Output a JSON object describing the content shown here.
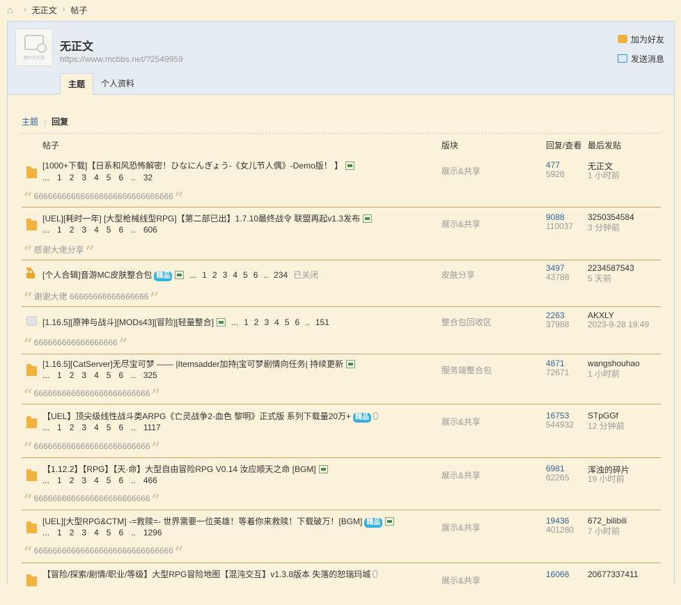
{
  "breadcrumb": {
    "items": [
      "无正文",
      "帖子"
    ]
  },
  "profile": {
    "avatar_caption": "图片已失效",
    "name": "无正文",
    "url": "https://www.mcbbs.net/?2549959",
    "add_friend": "加为好友",
    "send_message": "发送消息",
    "tabs": [
      "主题",
      "个人资料"
    ]
  },
  "subnav": {
    "threads": "主题",
    "replies": "回复"
  },
  "table": {
    "headers": {
      "post": "帖子",
      "forum": "版块",
      "counts": "回复/查看",
      "lastpost": "最后发贴"
    },
    "rows": [
      {
        "title": "[1000+下载]【日系和风恐怖解密！ひなにんぎょう-《女儿节人偶》-Demo版！ 】",
        "pages": [
          "...",
          "1",
          "2",
          "3",
          "4",
          "5",
          "6",
          "..",
          "32"
        ],
        "forum": "展示&共享",
        "replies": "477",
        "views": "5928",
        "last_user": "无正文",
        "last_time": "1 小时前",
        "reply_text": "666666666666666666666666666666"
      },
      {
        "title": "[UEL][耗时一年] [大型枪械线型RPG]【第二部已出】1.7.10最终战令 联盟再起v1.3发布",
        "pages": [
          "...",
          "1",
          "2",
          "3",
          "4",
          "5",
          "6",
          "..",
          "606"
        ],
        "forum": "展示&共享",
        "replies": "9088",
        "views": "110037",
        "last_user": "3250354584",
        "last_time": "3 分钟前",
        "reply_text": "感谢大佬分享"
      },
      {
        "title": "[个人合辑]音游MC皮肤整合包",
        "badge": "精品",
        "pages": [
          "...",
          "1",
          "2",
          "3",
          "4",
          "5",
          "6",
          "..",
          "234"
        ],
        "closed": "已关闭",
        "forum": "皮肤分享",
        "replies": "3497",
        "views": "43788",
        "last_user": "2234587543",
        "last_time": "5 天前",
        "reply_text": "谢谢大佬 66666666666666666"
      },
      {
        "title": "[1.16.5][原神与战斗][MODs43][冒险][轻量整合]",
        "pages": [
          "...",
          "1",
          "2",
          "3",
          "4",
          "5",
          "6",
          "..",
          "151"
        ],
        "forum": "整合包回收区",
        "replies": "2263",
        "views": "37988",
        "last_user": "AKXLY",
        "last_time": "2023-9-28 19:49",
        "reply_text": "666666666666666666"
      },
      {
        "title": "[1.16.5][CatServer]无尽宝可梦 —— |Itemsadder加持|宝可梦剧情向任务| 持续更新",
        "pages": [
          "...",
          "1",
          "2",
          "3",
          "4",
          "5",
          "6",
          "..",
          "325"
        ],
        "forum": "服务端整合包",
        "replies": "4871",
        "views": "72671",
        "last_user": "wangshouhao",
        "last_time": "1 小时前",
        "reply_text": "6666666666666666666666666"
      },
      {
        "title": "【UEL】顶尖级线性战斗类ARPG《亡灵战争2-血色 黎明》正式版 系列下载量20万+",
        "badge": "精品",
        "pages": [
          "...",
          "1",
          "2",
          "3",
          "4",
          "5",
          "6",
          "..",
          "1117"
        ],
        "forum": "展示&共享",
        "replies": "16753",
        "views": "544932",
        "last_user": "STpGGf",
        "last_time": "12 分钟前",
        "reply_text": "6666666666666666666666666"
      },
      {
        "title": "【1.12.2】【RPG】【天·命】大型自由冒险RPG V0.14 汝应顺天之命 [BGM]",
        "pages": [
          "...",
          "1",
          "2",
          "3",
          "4",
          "5",
          "6",
          "..",
          "466"
        ],
        "forum": "展示&共享",
        "replies": "6981",
        "views": "62265",
        "last_user": "浑浊的碎片",
        "last_time": "19 小时前",
        "reply_text": "6666666666666666666666666"
      },
      {
        "title": "[UEL][大型RPG&CTM] -=救赎=- 世界需要一位英雄！等着你来救赎！下载破万！[BGM]",
        "badge": "精品",
        "pages": [
          "...",
          "1",
          "2",
          "3",
          "4",
          "5",
          "6",
          "..",
          "1296"
        ],
        "forum": "展示&共享",
        "replies": "19436",
        "views": "401280",
        "last_user": "672_bilibili",
        "last_time": "7 小时前",
        "reply_text": "666666666666666666666666666666"
      },
      {
        "title": "【冒险/探索/剧情/职业/等级】大型RPG冒险地图【混沌交互】v1.3.8版本 失落的恕瑞玛城",
        "forum": "展示&共享",
        "replies": "16066",
        "views": "",
        "last_user": "20677337411",
        "last_time": ""
      }
    ]
  }
}
